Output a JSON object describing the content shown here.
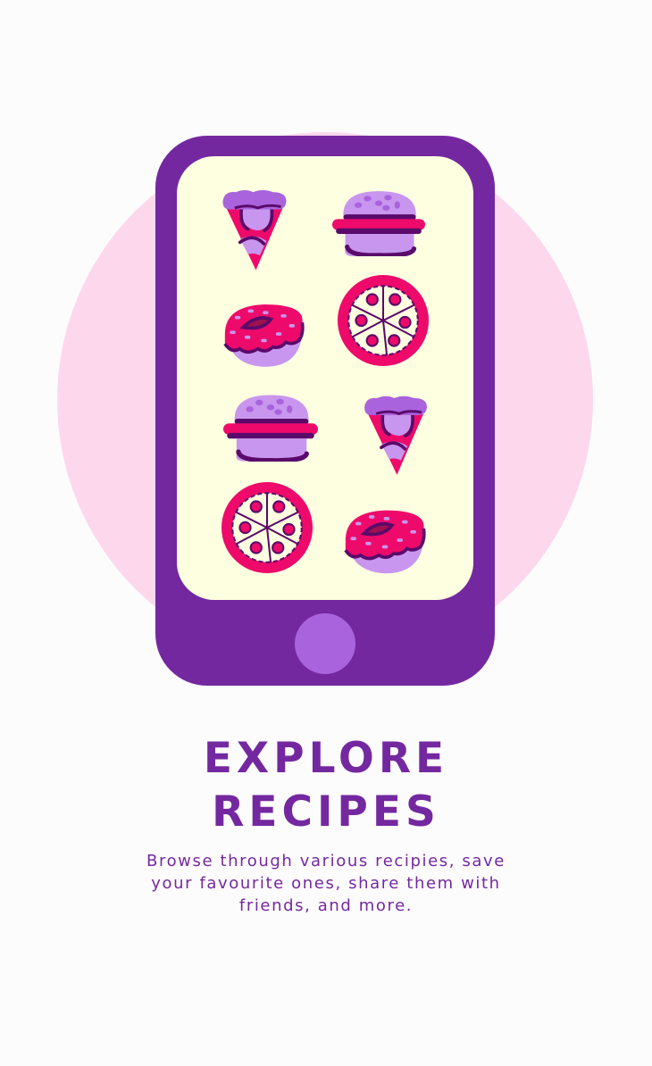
{
  "illustration": {
    "items": [
      "pizza-slice",
      "burger",
      "donut",
      "pizza",
      "burger",
      "pizza-slice",
      "pizza",
      "donut"
    ],
    "colors": {
      "phone": "#7428a0",
      "screen": "#fefee0",
      "background_circle": "#fdd8ec",
      "home_button": "#a963dd",
      "magenta": "#ee0a6a",
      "lavender": "#c896ee",
      "dark": "#5a0a6a"
    }
  },
  "onboarding": {
    "title_line1": "EXPLORE",
    "title_line2": "RECIPES",
    "description_lines": [
      "Browse through various recipies, save",
      "your favourite ones, share them with",
      "friends, and more."
    ]
  }
}
